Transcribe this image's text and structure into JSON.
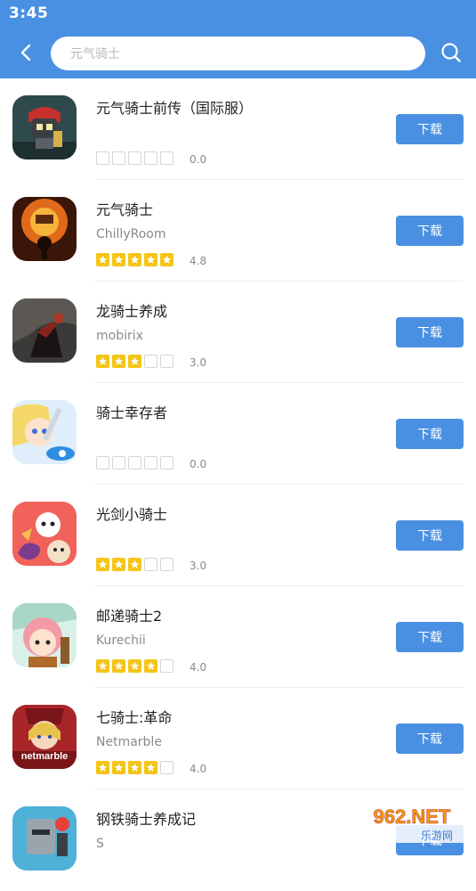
{
  "status_bar": {
    "time": "3:45"
  },
  "colors": {
    "primary": "#4a90e2",
    "star_on": "#f5c518"
  },
  "search": {
    "placeholder": "元气骑士"
  },
  "icons": {
    "back": "chevron-left-icon",
    "search": "search-icon",
    "star": "star-icon"
  },
  "apps": [
    {
      "name": "元气骑士前传（国际服）",
      "developer": "",
      "stars": 0,
      "rating": "0.0",
      "download_label": "下载"
    },
    {
      "name": "元气骑士",
      "developer": "ChillyRoom",
      "stars": 5,
      "rating": "4.8",
      "download_label": "下载"
    },
    {
      "name": "龙骑士养成",
      "developer": "mobirix",
      "stars": 3,
      "rating": "3.0",
      "download_label": "下载"
    },
    {
      "name": "骑士幸存者",
      "developer": "",
      "stars": 0,
      "rating": "0.0",
      "download_label": "下载"
    },
    {
      "name": "光剑小骑士",
      "developer": "",
      "stars": 3,
      "rating": "3.0",
      "download_label": "下载"
    },
    {
      "name": "邮递骑士2",
      "developer": "Kurechii",
      "stars": 4,
      "rating": "4.0",
      "download_label": "下载"
    },
    {
      "name": "七骑士:革命",
      "developer": "Netmarble",
      "stars": 4,
      "rating": "4.0",
      "download_label": "下载"
    },
    {
      "name": "钢铁骑士养成记",
      "developer": "S",
      "stars": 0,
      "rating": "",
      "download_label": "下载"
    }
  ],
  "icon_badges": {
    "netmarble": "netmarble"
  },
  "watermark": {
    "text": "962.NET",
    "sub": "乐游网"
  }
}
